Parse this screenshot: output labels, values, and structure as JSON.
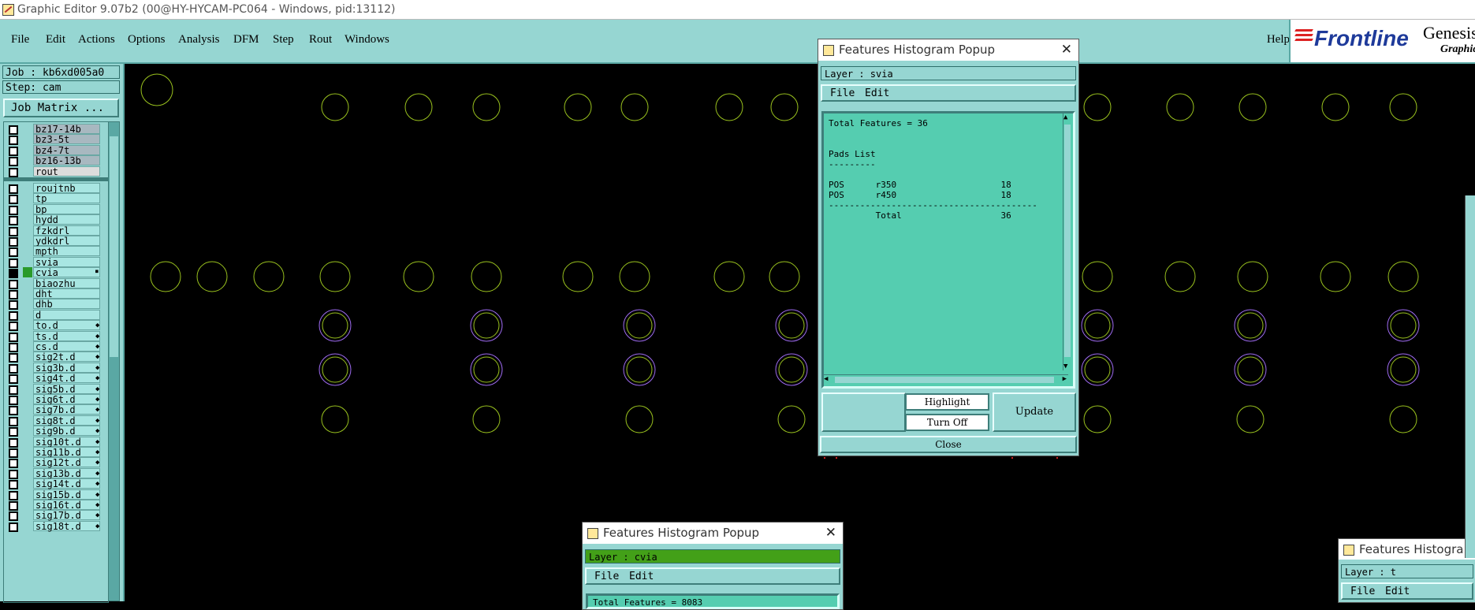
{
  "window": {
    "title": "Graphic Editor 9.07b2 (00@HY-HYCAM-PC064 - Windows, pid:13112)"
  },
  "menu": {
    "items": [
      "File",
      "Edit",
      "Actions",
      "Options",
      "Analysis",
      "DFM",
      "Step",
      "Rout",
      "Windows"
    ],
    "help": "Help",
    "logo": "Frontline",
    "brand": "Genesis",
    "brand_sub": "Graphic"
  },
  "left": {
    "job": "Job : kb6xd005a0",
    "step": "Step: cam",
    "job_matrix": "Job Matrix ...",
    "layers_top": [
      "bz17-14b",
      "bz3-5t",
      "bz4-7t",
      "bz16-13b",
      "rout"
    ],
    "layers": [
      "roujtnb",
      "tp",
      "bp",
      "hydd",
      "fzkdrl",
      "ydkdrl",
      "mpth",
      "svia",
      "cvia",
      "biaozhu",
      "dht",
      "dhb",
      "d",
      "to.d",
      "ts.d",
      "cs.d",
      "sig2t.d",
      "sig3b.d",
      "sig4t.d",
      "sig5b.d",
      "sig6t.d",
      "sig7b.d",
      "sig8t.d",
      "sig9b.d",
      "sig10t.d",
      "sig11b.d",
      "sig12t.d",
      "sig13b.d",
      "sig14t.d",
      "sig15b.d",
      "sig16t.d",
      "sig17b.d",
      "sig18t.d"
    ],
    "active_layer": "cvia",
    "marked_layers": [
      "to.d",
      "ts.d",
      "cs.d",
      "sig2t.d",
      "sig3b.d",
      "sig4t.d",
      "sig5b.d",
      "sig6t.d",
      "sig7b.d",
      "sig8t.d",
      "sig9b.d",
      "sig10t.d",
      "sig11b.d",
      "sig12t.d",
      "sig13b.d",
      "sig14t.d",
      "sig15b.d",
      "sig16t.d",
      "sig17b.d",
      "sig18t.d"
    ]
  },
  "colors": {
    "cyan_panel": "#96d6d2",
    "text_area": "#55cdb0",
    "pad_outline": "#9ac21e",
    "via_outline": "#9d6af0",
    "active_layer_bar": "#43a018"
  },
  "popup_main": {
    "title": "Features Histogram Popup",
    "layer": "Layer :  svia",
    "menu_file": "File",
    "menu_edit": "Edit",
    "text_lines": [
      "Total Features = 36",
      "",
      "",
      "Pads List",
      "---------",
      "",
      "POS      r350                    18",
      "POS      r450                    18",
      "----------------------------------------",
      "         Total                   36"
    ],
    "highlight": "Highlight",
    "turn_off": "Turn Off",
    "update": "Update",
    "close": "Close"
  },
  "popup_bottom": {
    "title": "Features Histogram Popup",
    "layer": "Layer :  cvia",
    "menu_file": "File",
    "menu_edit": "Edit",
    "text_partial": "Total Features = 8083"
  },
  "popup_right": {
    "title": "Features Histogra",
    "layer": "Layer :  t",
    "menu_file": "File",
    "menu_edit": "Edit"
  }
}
